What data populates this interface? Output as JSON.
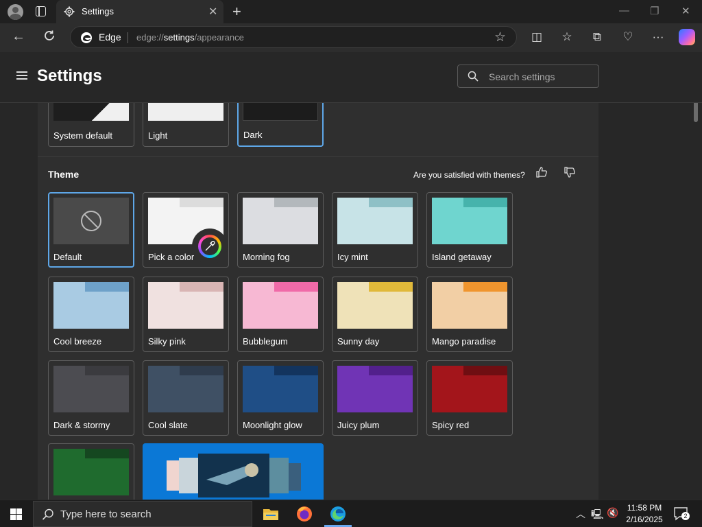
{
  "browser": {
    "tab_title": "Settings",
    "address_site": "Edge",
    "address_url_prefix": "edge://",
    "address_url_host": "settings",
    "address_url_path": "/appearance"
  },
  "settings": {
    "title": "Settings",
    "search_placeholder": "Search settings"
  },
  "appearance_modes": [
    {
      "label": "System default"
    },
    {
      "label": "Light"
    },
    {
      "label": "Dark",
      "selected": true
    }
  ],
  "theme_section": {
    "heading": "Theme",
    "feedback_question": "Are you satisfied with themes?"
  },
  "themes": [
    {
      "label": "Default",
      "selected": true
    },
    {
      "label": "Pick a color"
    },
    {
      "label": "Morning fog",
      "tab": "#b3b8bc",
      "body": "#dcdde1"
    },
    {
      "label": "Icy mint",
      "tab": "#8ec0c6",
      "body": "#c7e3e7"
    },
    {
      "label": "Island getaway",
      "tab": "#46b3ac",
      "body": "#6fd5cf"
    },
    {
      "label": "Cool breeze",
      "tab": "#6ea1c9",
      "body": "#a9cbe3"
    },
    {
      "label": "Silky pink",
      "tab": "#d9b5b4",
      "body": "#f0e1e0"
    },
    {
      "label": "Bubblegum",
      "tab": "#f06aa8",
      "body": "#f7b8d3"
    },
    {
      "label": "Sunny day",
      "tab": "#e0b93a",
      "body": "#efe2b8"
    },
    {
      "label": "Mango paradise",
      "tab": "#f0952e",
      "body": "#f2cfa5"
    },
    {
      "label": "Dark & stormy",
      "tab": "#3b3b3f",
      "body": "#4c4c51"
    },
    {
      "label": "Cool slate",
      "tab": "#2f3c4d",
      "body": "#3f5064"
    },
    {
      "label": "Moonlight glow",
      "tab": "#13345e",
      "body": "#1f4e86"
    },
    {
      "label": "Juicy plum",
      "tab": "#52208c",
      "body": "#7034b5"
    },
    {
      "label": "Spicy red",
      "tab": "#6f0e12",
      "body": "#a3151b"
    },
    {
      "label": "",
      "tab": "#154720",
      "body": "#1f6b2e"
    }
  ],
  "taskbar": {
    "search_placeholder": "Type here to search",
    "time": "11:58 PM",
    "date": "2/16/2025",
    "notification_count": "2"
  }
}
